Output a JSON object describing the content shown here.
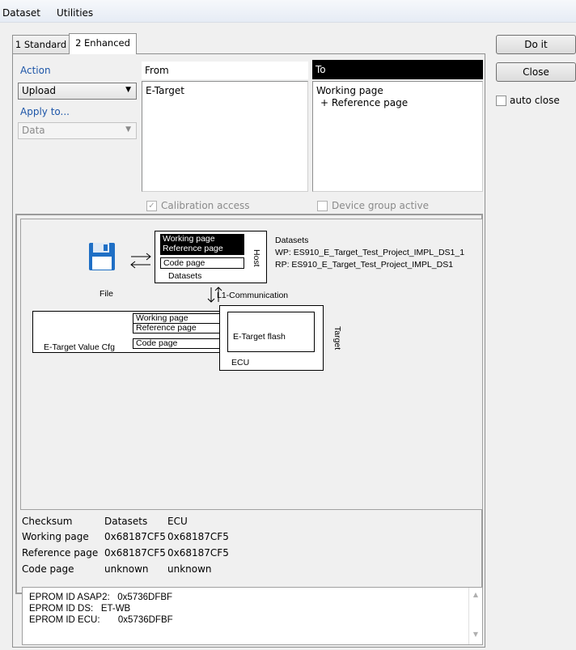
{
  "menu": {
    "dataset": "Dataset",
    "utilities": "Utilities"
  },
  "tabs": [
    {
      "label": "1 Standard"
    },
    {
      "label": "2 Enhanced"
    }
  ],
  "action": {
    "label": "Action",
    "value": "Upload"
  },
  "apply_to": {
    "label": "Apply to...",
    "value": "Data"
  },
  "from": {
    "header": "From",
    "items": [
      "E-Target"
    ]
  },
  "to": {
    "header": "To",
    "items": [
      "Working page",
      "+ Reference page"
    ]
  },
  "options": {
    "calibration_access": "Calibration access",
    "device_group_active": "Device group active"
  },
  "diagram": {
    "host_working_page": "Working page",
    "host_reference_page": "Reference page",
    "host_code_page": "Code page",
    "host_datasets": "Datasets",
    "host_label": "Host",
    "datasets_title": "Datasets",
    "wp_line": "WP: ES910_E_Target_Test_Project_IMPL_DS1_1",
    "rp_line": "RP: ES910_E_Target_Test_Project_IMPL_DS1",
    "file_label": "File",
    "l1_label": "L1-Communication",
    "cfg_working_page": "Working page",
    "cfg_reference_page": "Reference page",
    "cfg_code_page": "Code page",
    "cfg_label": "E-Target Value Cfg",
    "flash_label": "E-Target flash",
    "ecu_label": "ECU",
    "target_label": "Target"
  },
  "checksum": {
    "headers": [
      "Checksum",
      "Datasets",
      "ECU"
    ],
    "rows": [
      [
        "Working page",
        "0x68187CF5",
        "0x68187CF5"
      ],
      [
        "Reference page",
        "0x68187CF5",
        "0x68187CF5"
      ],
      [
        "Code page",
        "unknown",
        "unknown"
      ]
    ]
  },
  "eprom": [
    "EPROM ID ASAP2:   0x5736DFBF",
    "EPROM ID DS:   ET-WB",
    "EPROM ID ECU:       0x5736DFBF"
  ],
  "buttons": {
    "do_it": "Do it",
    "close": "Close"
  },
  "auto_close": {
    "label": "auto close",
    "checked": false
  }
}
